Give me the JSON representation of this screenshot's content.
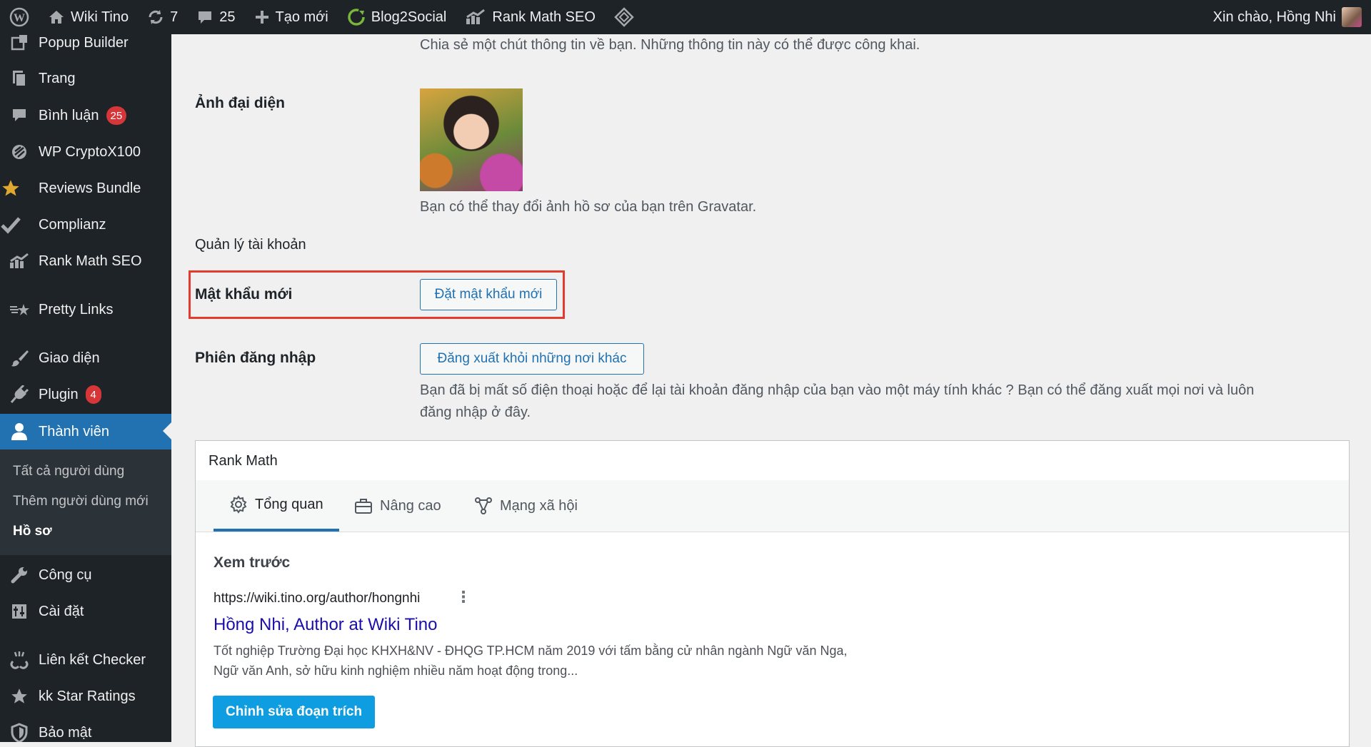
{
  "adminbar": {
    "site_name": "Wiki Tino",
    "updates_count": "7",
    "comments_count": "25",
    "new_label": "Tạo mới",
    "blog2social": "Blog2Social",
    "rankmath": "Rank Math SEO",
    "greeting": "Xin chào, Hồng Nhi"
  },
  "sidebar": {
    "items": [
      {
        "label": "Popup Builder",
        "icon": "popup-icon"
      },
      {
        "label": "Trang",
        "icon": "page-icon"
      },
      {
        "label": "Bình luận",
        "icon": "comment-icon",
        "badge": "25"
      },
      {
        "label": "WP CryptoX100",
        "icon": "crypto-icon"
      },
      {
        "label": "Reviews Bundle",
        "icon": "star-icon"
      },
      {
        "label": "Complianz",
        "icon": "check-icon"
      },
      {
        "label": "Rank Math SEO",
        "icon": "chart-icon"
      },
      {
        "label": "Pretty Links",
        "icon": "star-link-icon"
      },
      {
        "label": "Giao diện",
        "icon": "brush-icon"
      },
      {
        "label": "Plugin",
        "icon": "plugin-icon",
        "badge": "4"
      },
      {
        "label": "Thành viên",
        "icon": "user-icon"
      },
      {
        "label": "Công cụ",
        "icon": "wrench-icon"
      },
      {
        "label": "Cài đặt",
        "icon": "settings-icon"
      },
      {
        "label": "Liên kết Checker",
        "icon": "link-checker-icon"
      },
      {
        "label": "kk Star Ratings",
        "icon": "star-icon"
      },
      {
        "label": "Bảo mật",
        "icon": "shield-icon"
      }
    ],
    "submenu": [
      "Tất cả người dùng",
      "Thêm người dùng mới",
      "Hồ sơ"
    ]
  },
  "profile": {
    "bio_desc": "Chia sẻ một chút thông tin về bạn. Những thông tin này có thể được công khai.",
    "avatar_label": "Ảnh đại diện",
    "avatar_desc": "Bạn có thể thay đổi ảnh hồ sơ của bạn trên Gravatar.",
    "account_heading": "Quản lý tài khoản",
    "new_password_label": "Mật khẩu mới",
    "new_password_button": "Đặt mật khẩu mới",
    "sessions_label": "Phiên đăng nhập",
    "sessions_button": "Đăng xuất khỏi những nơi khác",
    "sessions_desc_1": "Bạn đã bị mất số điện thoại hoặc để lại tài khoản đăng nhập của bạn vào một máy tính khác ? Bạn có thể đăng xuất mọi nơi và luôn",
    "sessions_desc_2": "đăng nhập ở đây."
  },
  "rankmath": {
    "title": "Rank Math",
    "tabs": [
      "Tổng quan",
      "Nâng cao",
      "Mạng xã hội"
    ],
    "preview_heading": "Xem trước",
    "serp_url": "https://wiki.tino.org/author/hongnhi",
    "serp_title": "Hồng Nhi, Author at Wiki Tino",
    "serp_desc": "Tốt nghiệp Trường Đại học KHXH&NV - ĐHQG TP.HCM năm 2019 với tấm bằng cử nhân ngành Ngữ văn Nga, Ngữ văn Anh, sở hữu kinh nghiệm nhiều năm hoạt động trong...",
    "edit_button": "Chỉnh sửa đoạn trích"
  }
}
